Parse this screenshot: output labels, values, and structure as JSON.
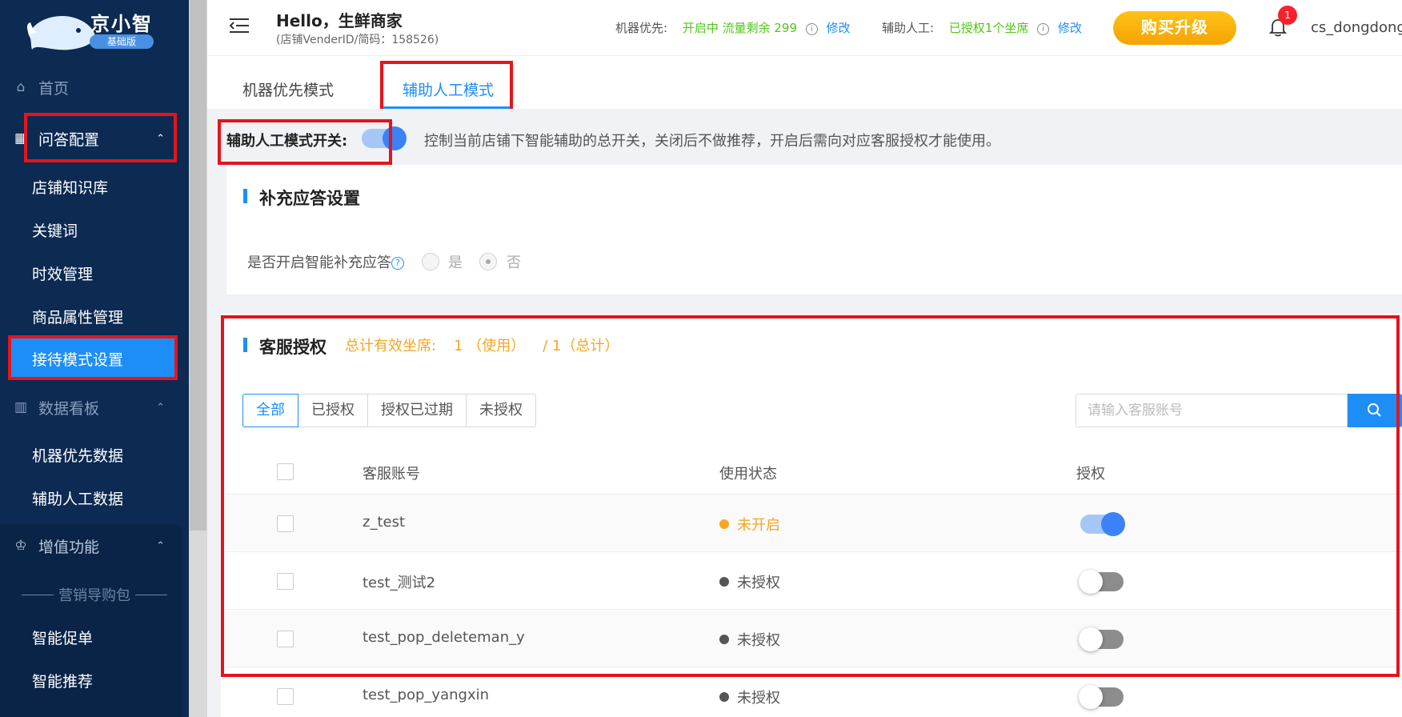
{
  "sidebar": {
    "brand": "京小智",
    "edition": "基础版",
    "home": "首页",
    "qa_config": "问答配置",
    "qa_items": [
      "店铺知识库",
      "关键词",
      "时效管理",
      "商品属性管理",
      "接待模式设置"
    ],
    "dashboard": "数据看板",
    "dashboard_items": [
      "机器优先数据",
      "辅助人工数据"
    ],
    "value_added": "增值功能",
    "marketing_group": "营销导购包",
    "marketing_items": [
      "智能促单",
      "智能推荐"
    ],
    "colors": {
      "bg": "#0c2a52",
      "active": "#1e8ef7",
      "highlight_box": "#e5141c"
    }
  },
  "header": {
    "greeting": "Hello，生鲜商家",
    "vender_info": "(店铺VenderID/简码：158526)",
    "machine_label": "机器优先:",
    "machine_status": "开启中 流量剩余 299",
    "machine_edit": "修改",
    "assist_label": "辅助人工:",
    "assist_status": "已授权1个坐席",
    "assist_edit": "修改",
    "buy_button": "购买升级",
    "notification_count": "1",
    "username": "cs_dongdong"
  },
  "tabs": [
    {
      "label": "机器优先模式",
      "active": false
    },
    {
      "label": "辅助人工模式",
      "active": true
    }
  ],
  "switch_row": {
    "label": "辅助人工模式开关:",
    "enabled": true,
    "description": "控制当前店铺下智能辅助的总开关，关闭后不做推荐，开启后需向对应客服授权才能使用。"
  },
  "supplement": {
    "title": "补充应答设置",
    "question": "是否开启智能补充应答",
    "options": [
      "是",
      "否"
    ],
    "selected": "否"
  },
  "authorization": {
    "title": "客服授权",
    "summary_label": "总计有效坐席:",
    "summary_used": "1 （使用）",
    "summary_total": "/ 1（总计）",
    "filters": [
      "全部",
      "已授权",
      "授权已过期",
      "未授权"
    ],
    "active_filter": "全部",
    "search_placeholder": "请输入客服账号",
    "columns": [
      "客服账号",
      "使用状态",
      "授权"
    ],
    "rows": [
      {
        "account": "z_test",
        "status": "未开启",
        "status_color": "#f5a623",
        "authorized": true
      },
      {
        "account": "test_测试2",
        "status": "未授权",
        "status_color": "#555555",
        "authorized": false
      },
      {
        "account": "test_pop_deleteman_y",
        "status": "未授权",
        "status_color": "#555555",
        "authorized": false
      },
      {
        "account": "test_pop_yangxin",
        "status": "未授权",
        "status_color": "#555555",
        "authorized": false
      }
    ]
  }
}
